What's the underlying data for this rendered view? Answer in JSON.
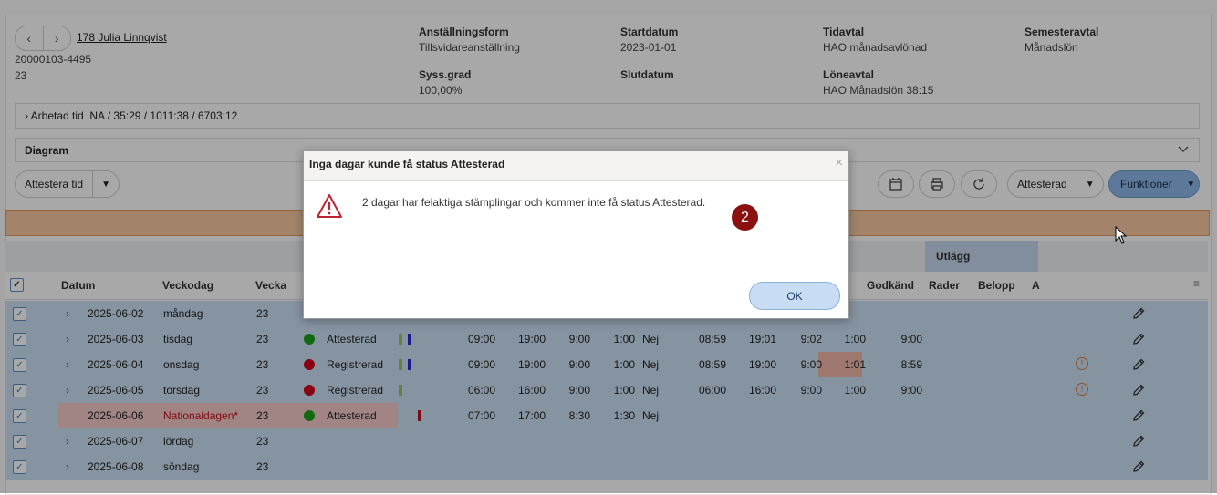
{
  "employee": {
    "link": "178 Julia Linnqvist",
    "personnr": "20000103-4495",
    "number": "23"
  },
  "info": [
    {
      "label": "Anställningsform",
      "value": "Tillsvidareanställning"
    },
    {
      "label": "Startdatum",
      "value": "2023-01-01"
    },
    {
      "label": "Tidavtal",
      "value": "HAO månadsavlönad"
    },
    {
      "label": "Semesteravtal",
      "value": "Månadslön"
    },
    {
      "label": "Syss.grad",
      "value": "100,00%"
    },
    {
      "label": "Slutdatum",
      "value": ""
    },
    {
      "label": "Löneavtal",
      "value": "HAO Månadslön 38:15"
    }
  ],
  "arbetad": {
    "label": "Arbetad tid",
    "value": "NA / 35:29 / 1011:38 / 6703:12"
  },
  "diagram_label": "Diagram",
  "toolbar": {
    "attestera": "Attestera tid",
    "status": "Attesterad",
    "funktioner": "Funktioner"
  },
  "table": {
    "group_utlagg": "Utlägg",
    "headers": {
      "datum": "Datum",
      "veckodag": "Veckodag",
      "vecka": "Vecka",
      "godkand": "Godkänd",
      "rader": "Rader",
      "belopp": "Belopp",
      "a": "A"
    },
    "rows": [
      {
        "date": "2025-06-02",
        "day": "måndag",
        "week": "23",
        "status": "",
        "dot": "",
        "s1": "",
        "e1": "",
        "t1": "",
        "b1": "",
        "n": "",
        "s2": "",
        "e2": "",
        "t2": "",
        "b2": "",
        "g": "",
        "warn": false,
        "holiday": false
      },
      {
        "date": "2025-06-03",
        "day": "tisdag",
        "week": "23",
        "status": "Attesterad",
        "dot": "#1aa11a",
        "s1": "09:00",
        "e1": "19:00",
        "t1": "9:00",
        "b1": "1:00",
        "n": "Nej",
        "s2": "08:59",
        "e2": "19:01",
        "t2": "9:02",
        "b2": "1:00",
        "g": "9:00",
        "warn": false,
        "holiday": false
      },
      {
        "date": "2025-06-04",
        "day": "onsdag",
        "week": "23",
        "status": "Registrerad",
        "dot": "#d0001a",
        "s1": "09:00",
        "e1": "19:00",
        "t1": "9:00",
        "b1": "1:00",
        "n": "Nej",
        "s2": "08:59",
        "e2": "19:00",
        "t2": "9:00",
        "b2": "1:01",
        "g": "8:59",
        "warn": true,
        "holiday": false
      },
      {
        "date": "2025-06-05",
        "day": "torsdag",
        "week": "23",
        "status": "Registrerad",
        "dot": "#d0001a",
        "s1": "06:00",
        "e1": "16:00",
        "t1": "9:00",
        "b1": "1:00",
        "n": "Nej",
        "s2": "06:00",
        "e2": "16:00",
        "t2": "9:00",
        "b2": "1:00",
        "g": "9:00",
        "warn": true,
        "holiday": false
      },
      {
        "date": "2025-06-06",
        "day": "Nationaldagen*",
        "week": "23",
        "status": "Attesterad",
        "dot": "#1aa11a",
        "s1": "07:00",
        "e1": "17:00",
        "t1": "8:30",
        "b1": "1:30",
        "n": "Nej",
        "s2": "",
        "e2": "",
        "t2": "",
        "b2": "",
        "g": "",
        "warn": false,
        "holiday": true
      },
      {
        "date": "2025-06-07",
        "day": "lördag",
        "week": "23",
        "status": "",
        "dot": "",
        "s1": "",
        "e1": "",
        "t1": "",
        "b1": "",
        "n": "",
        "s2": "",
        "e2": "",
        "t2": "",
        "b2": "",
        "g": "",
        "warn": false,
        "holiday": false
      },
      {
        "date": "2025-06-08",
        "day": "söndag",
        "week": "23",
        "status": "",
        "dot": "",
        "s1": "",
        "e1": "",
        "t1": "",
        "b1": "",
        "n": "",
        "s2": "",
        "e2": "",
        "t2": "",
        "b2": "",
        "g": "",
        "warn": false,
        "holiday": false
      }
    ]
  },
  "modal": {
    "title": "Inga dagar kunde få status Attesterad",
    "message": "2 dagar har felaktiga stämplingar och kommer inte få status Attesterad.",
    "ok": "OK",
    "close": "×"
  },
  "badge": "2",
  "colors": {
    "accent": "#8eb8ea",
    "row": "#cbe0f5",
    "warning": "#e07a3a",
    "badge": "#8b1010"
  }
}
